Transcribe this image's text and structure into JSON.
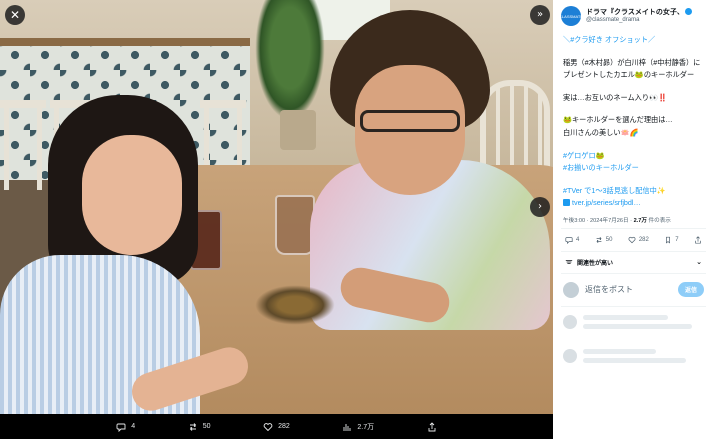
{
  "viewer": {
    "close_label": "✕",
    "next_label": "»",
    "next_mid_label": "›"
  },
  "actions": {
    "reply_count": "4",
    "repost_count": "50",
    "like_count": "282",
    "view_count": "2.7万"
  },
  "tweet": {
    "avatar_text": "CLASSMATE",
    "display_name": "ドラマ『クラスメイトの女子、",
    "handle": "@classmate_drama",
    "line1": "＼#クラ好き オフショット／",
    "line2": "稲男（#木村昴）が白川梓（#中村静香）に",
    "line3": "プレゼントしたカエル🐸のキーホルダー",
    "line4": "実は…お互いのネーム入り👀‼️",
    "line5": "🐸キーホルダーを選んだ理由は…",
    "line6": "白川さんの美しい🪷🌈",
    "hashtag1": "#ゲロゲロ🐸",
    "hashtag2": "#お揃いのキーホルダー",
    "line7": "#TVer で1〜3話見逃し配信中✨",
    "link": "tver.jp/series/srfjbdl…",
    "time": "午後3:00 · 2024年7月26日 · ",
    "views_bold": "2.7万",
    "views_label": " 件の表示"
  },
  "stats": {
    "replies": "4",
    "reposts": "50",
    "likes": "282",
    "bookmarks": "7"
  },
  "relevance_label": "関連性が高い",
  "reply": {
    "placeholder": "返信をポスト",
    "button": "返信"
  }
}
